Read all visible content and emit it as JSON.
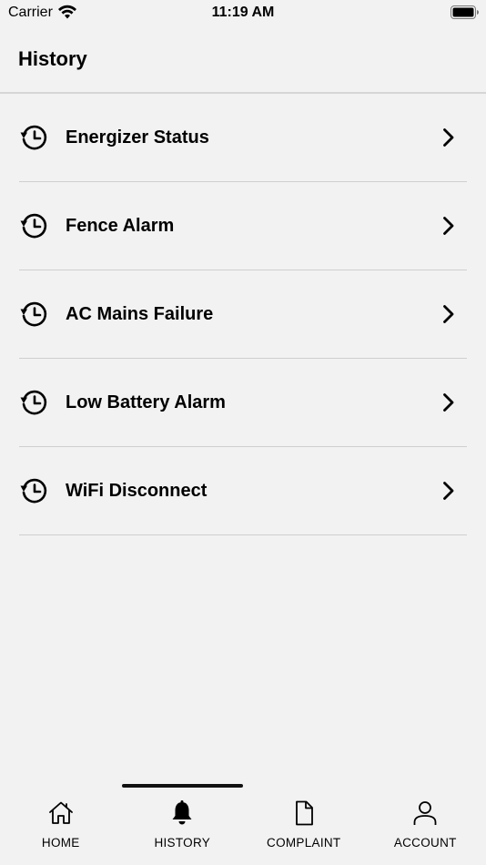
{
  "status_bar": {
    "carrier": "Carrier",
    "time": "11:19 AM"
  },
  "header": {
    "title": "History"
  },
  "history_items": [
    {
      "label": "Energizer Status",
      "icon": "history-clock-icon"
    },
    {
      "label": "Fence Alarm",
      "icon": "history-clock-icon"
    },
    {
      "label": "AC Mains Failure",
      "icon": "history-clock-icon"
    },
    {
      "label": "Low Battery Alarm",
      "icon": "history-clock-icon"
    },
    {
      "label": "WiFi Disconnect",
      "icon": "history-clock-icon"
    }
  ],
  "tab_bar": {
    "active": "HISTORY",
    "tabs": [
      {
        "label": "HOME",
        "icon": "home-icon"
      },
      {
        "label": "HISTORY",
        "icon": "bell-icon"
      },
      {
        "label": "COMPLAINT",
        "icon": "document-icon"
      },
      {
        "label": "ACCOUNT",
        "icon": "user-icon"
      }
    ]
  },
  "colors": {
    "background": "#f2f2f2",
    "text": "#000000",
    "divider": "#cfcfcf"
  }
}
